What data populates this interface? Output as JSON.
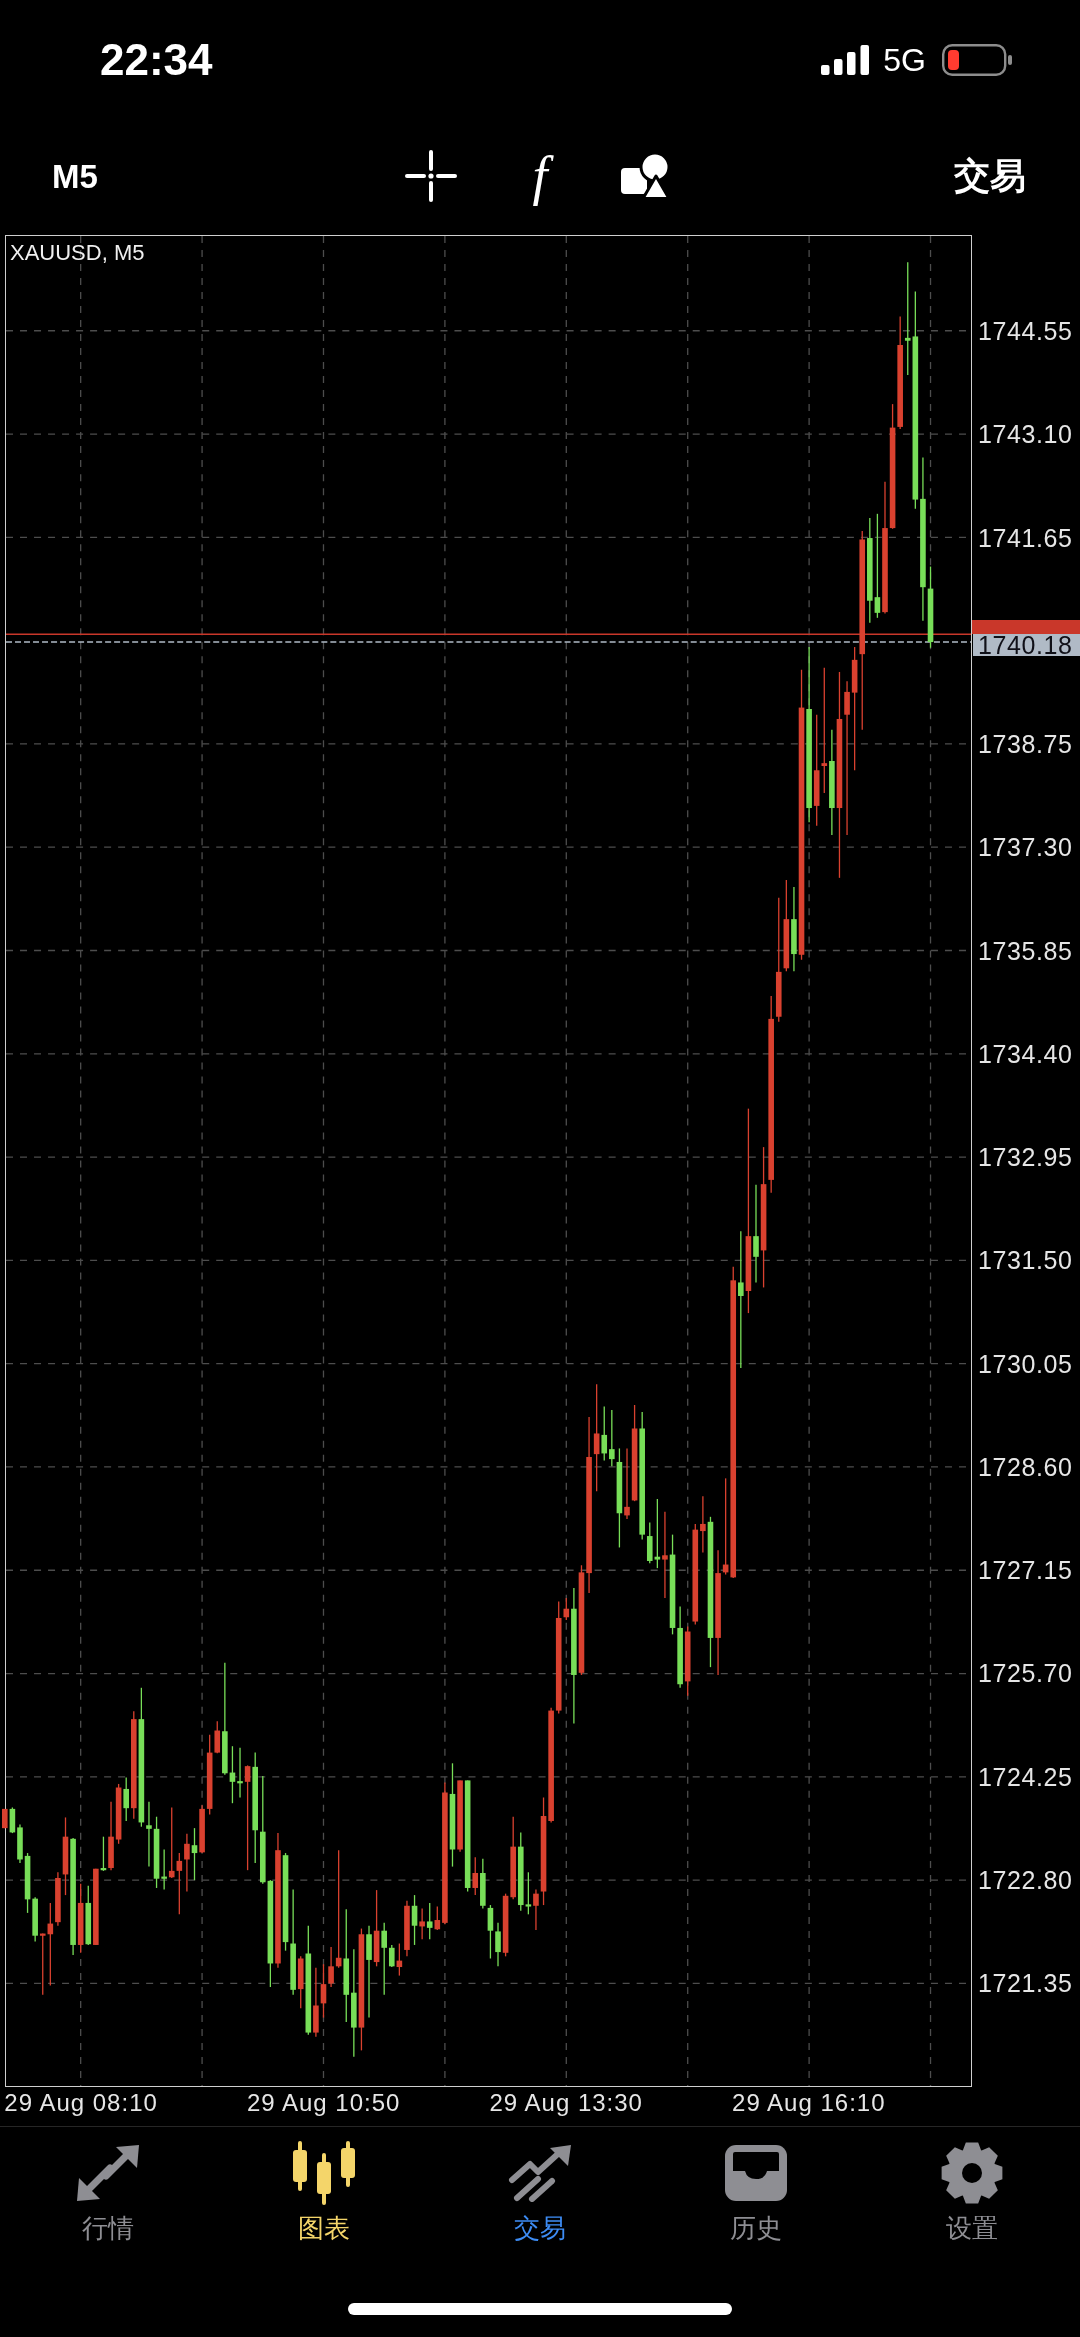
{
  "status_bar": {
    "time": "22:34",
    "network": "5G"
  },
  "toolbar": {
    "timeframe": "M5",
    "indicator_button": "f",
    "trade_button": "交易"
  },
  "chart": {
    "chart_data": {
      "type": "candlestick",
      "title": "XAUUSD, M5",
      "grid": true,
      "categories": [
        null,
        null,
        null,
        null,
        null,
        null,
        null,
        null,
        null,
        null,
        "29 Aug 08:10",
        null,
        null,
        null,
        null,
        null,
        null,
        null,
        null,
        null,
        null,
        null,
        null,
        null,
        null,
        null,
        null,
        null,
        null,
        null,
        null,
        null,
        null,
        null,
        null,
        null,
        null,
        null,
        null,
        null,
        null,
        null,
        "29 Aug 10:50",
        null,
        null,
        null,
        null,
        null,
        null,
        null,
        null,
        null,
        null,
        null,
        null,
        null,
        null,
        null,
        null,
        null,
        null,
        null,
        null,
        null,
        null,
        null,
        null,
        null,
        null,
        null,
        null,
        null,
        null,
        null,
        "29 Aug 13:30",
        null,
        null,
        null,
        null,
        null,
        null,
        null,
        null,
        null,
        null,
        null,
        null,
        null,
        null,
        null,
        null,
        null,
        null,
        null,
        null,
        null,
        null,
        null,
        null,
        null,
        null,
        null,
        null,
        null,
        null,
        null,
        "29 Aug 16:10",
        null,
        null,
        null,
        null,
        null,
        null,
        null,
        null,
        null,
        null,
        null,
        null,
        null,
        null,
        null,
        null
      ],
      "ohlc": [
        [
          1723.53,
          1723.8,
          1723.53,
          1723.8
        ],
        [
          1723.8,
          1723.82,
          1723.46,
          1723.47
        ],
        [
          1723.54,
          1723.58,
          1723.04,
          1723.09
        ],
        [
          1723.14,
          1723.18,
          1722.34,
          1722.53
        ],
        [
          1722.54,
          1722.56,
          1721.94,
          1722.02
        ],
        [
          1722.02,
          1722.05,
          1721.19,
          1722.05
        ],
        [
          1722.04,
          1722.48,
          1721.32,
          1722.19
        ],
        [
          1722.21,
          1722.91,
          1722.16,
          1722.83
        ],
        [
          1722.88,
          1723.68,
          1722.59,
          1723.41
        ],
        [
          1723.38,
          1723.39,
          1721.75,
          1721.89
        ],
        [
          1721.89,
          1722.75,
          1721.78,
          1722.48
        ],
        [
          1722.48,
          1722.72,
          1721.89,
          1721.9
        ],
        [
          1721.89,
          1722.96,
          1721.89,
          1722.96
        ],
        [
          1722.97,
          1723.41,
          1722.93,
          1722.94
        ],
        [
          1722.97,
          1723.9,
          1722.94,
          1723.41
        ],
        [
          1723.37,
          1724.15,
          1723.31,
          1724.1
        ],
        [
          1724.08,
          1724.24,
          1723.63,
          1723.81
        ],
        [
          1723.81,
          1725.17,
          1723.66,
          1725.06
        ],
        [
          1725.06,
          1725.5,
          1723.55,
          1723.61
        ],
        [
          1723.57,
          1723.9,
          1722.99,
          1723.52
        ],
        [
          1723.52,
          1723.69,
          1722.69,
          1722.82
        ],
        [
          1722.85,
          1723.23,
          1722.67,
          1722.82
        ],
        [
          1722.84,
          1723.82,
          1722.83,
          1722.93
        ],
        [
          1722.93,
          1723.18,
          1722.32,
          1723.07
        ],
        [
          1723.09,
          1723.45,
          1722.64,
          1723.31
        ],
        [
          1723.29,
          1723.53,
          1722.8,
          1723.18
        ],
        [
          1723.19,
          1723.85,
          1723.18,
          1723.8
        ],
        [
          1723.8,
          1724.84,
          1723.72,
          1724.59
        ],
        [
          1724.59,
          1725.03,
          1724.58,
          1724.9
        ],
        [
          1724.89,
          1725.85,
          1724.28,
          1724.3
        ],
        [
          1724.31,
          1724.68,
          1723.88,
          1724.18
        ],
        [
          1724.19,
          1724.66,
          1723.96,
          1724.17
        ],
        [
          1724.18,
          1724.41,
          1722.94,
          1724.4
        ],
        [
          1724.39,
          1724.59,
          1723.04,
          1723.5
        ],
        [
          1723.48,
          1724.26,
          1722.75,
          1722.77
        ],
        [
          1722.79,
          1722.8,
          1721.3,
          1721.63
        ],
        [
          1721.63,
          1723.46,
          1721.57,
          1723.22
        ],
        [
          1723.15,
          1723.18,
          1721.81,
          1721.93
        ],
        [
          1721.91,
          1722.67,
          1721.19,
          1721.26
        ],
        [
          1721.27,
          1721.73,
          1721.0,
          1721.7
        ],
        [
          1721.77,
          1722.16,
          1720.63,
          1720.66
        ],
        [
          1720.66,
          1721.57,
          1720.6,
          1721.04
        ],
        [
          1721.07,
          1721.62,
          1720.87,
          1721.34
        ],
        [
          1721.35,
          1721.86,
          1721.3,
          1721.59
        ],
        [
          1721.59,
          1723.22,
          1721.57,
          1721.71
        ],
        [
          1721.7,
          1722.39,
          1720.81,
          1721.19
        ],
        [
          1721.22,
          1721.83,
          1720.32,
          1720.73
        ],
        [
          1720.73,
          1722.12,
          1720.41,
          1722.04
        ],
        [
          1722.04,
          1722.16,
          1720.87,
          1721.68
        ],
        [
          1721.65,
          1722.66,
          1721.59,
          1722.09
        ],
        [
          1722.09,
          1722.2,
          1721.19,
          1721.85
        ],
        [
          1721.85,
          1721.89,
          1721.58,
          1721.59
        ],
        [
          1721.58,
          1721.91,
          1721.46,
          1721.67
        ],
        [
          1721.82,
          1722.51,
          1721.73,
          1722.44
        ],
        [
          1722.44,
          1722.59,
          1721.89,
          1722.16
        ],
        [
          1722.15,
          1722.4,
          1721.97,
          1722.22
        ],
        [
          1722.22,
          1722.48,
          1721.97,
          1722.13
        ],
        [
          1722.11,
          1722.43,
          1722.1,
          1722.24
        ],
        [
          1722.2,
          1724.17,
          1722.18,
          1724.03
        ],
        [
          1724.01,
          1724.44,
          1722.99,
          1723.23
        ],
        [
          1723.23,
          1724.2,
          1723.2,
          1724.2
        ],
        [
          1724.2,
          1724.2,
          1722.64,
          1722.69
        ],
        [
          1722.69,
          1723.12,
          1722.59,
          1722.9
        ],
        [
          1722.9,
          1723.1,
          1722.4,
          1722.44
        ],
        [
          1722.41,
          1722.45,
          1721.7,
          1722.09
        ],
        [
          1722.08,
          1722.2,
          1721.59,
          1721.79
        ],
        [
          1721.78,
          1722.61,
          1721.73,
          1722.58
        ],
        [
          1722.56,
          1723.69,
          1722.53,
          1723.27
        ],
        [
          1723.27,
          1723.47,
          1722.37,
          1722.45
        ],
        [
          1722.46,
          1722.91,
          1722.32,
          1722.44
        ],
        [
          1722.44,
          1722.67,
          1722.1,
          1722.61
        ],
        [
          1722.64,
          1723.96,
          1722.45,
          1723.7
        ],
        [
          1723.63,
          1725.22,
          1723.61,
          1725.18
        ],
        [
          1725.18,
          1726.71,
          1725.14,
          1726.48
        ],
        [
          1726.49,
          1726.76,
          1726.45,
          1726.61
        ],
        [
          1726.61,
          1726.9,
          1725.0,
          1725.68
        ],
        [
          1725.71,
          1727.22,
          1725.68,
          1727.12
        ],
        [
          1727.11,
          1729.3,
          1726.83,
          1728.74
        ],
        [
          1728.78,
          1729.76,
          1728.26,
          1729.07
        ],
        [
          1729.05,
          1729.45,
          1728.69,
          1728.79
        ],
        [
          1728.85,
          1729.4,
          1728.61,
          1728.71
        ],
        [
          1728.67,
          1728.86,
          1727.47,
          1727.95
        ],
        [
          1727.92,
          1728.86,
          1727.87,
          1728.04
        ],
        [
          1728.13,
          1729.47,
          1728.12,
          1729.14
        ],
        [
          1729.14,
          1729.37,
          1727.58,
          1727.65
        ],
        [
          1727.63,
          1727.82,
          1727.25,
          1727.28
        ],
        [
          1727.34,
          1728.15,
          1727.18,
          1727.3
        ],
        [
          1727.3,
          1727.97,
          1726.76,
          1727.36
        ],
        [
          1727.37,
          1727.65,
          1726.25,
          1726.34
        ],
        [
          1726.34,
          1726.64,
          1725.5,
          1725.55
        ],
        [
          1725.59,
          1726.36,
          1725.39,
          1726.29
        ],
        [
          1726.43,
          1727.8,
          1726.39,
          1727.72
        ],
        [
          1727.7,
          1728.19,
          1727.4,
          1727.8
        ],
        [
          1727.83,
          1727.9,
          1725.79,
          1726.2
        ],
        [
          1726.2,
          1727.43,
          1725.68,
          1727.11
        ],
        [
          1727.12,
          1728.44,
          1727.09,
          1727.23
        ],
        [
          1727.05,
          1731.41,
          1727.04,
          1731.22
        ],
        [
          1731.19,
          1731.91,
          1729.99,
          1731.0
        ],
        [
          1731.07,
          1733.63,
          1730.76,
          1731.84
        ],
        [
          1731.84,
          1732.56,
          1731.19,
          1731.55
        ],
        [
          1731.64,
          1733.09,
          1731.12,
          1732.57
        ],
        [
          1732.63,
          1735.21,
          1732.45,
          1734.89
        ],
        [
          1734.92,
          1736.59,
          1734.85,
          1735.55
        ],
        [
          1735.6,
          1736.84,
          1735.56,
          1736.29
        ],
        [
          1736.29,
          1736.74,
          1735.56,
          1735.8
        ],
        [
          1735.79,
          1739.79,
          1735.72,
          1739.26
        ],
        [
          1739.24,
          1740.11,
          1737.65,
          1737.85
        ],
        [
          1737.88,
          1739.16,
          1737.6,
          1738.38
        ],
        [
          1738.44,
          1739.82,
          1738.06,
          1738.48
        ],
        [
          1738.51,
          1738.95,
          1737.47,
          1737.85
        ],
        [
          1737.85,
          1739.76,
          1736.87,
          1739.1
        ],
        [
          1739.16,
          1739.63,
          1737.47,
          1739.48
        ],
        [
          1739.47,
          1740.11,
          1738.38,
          1739.93
        ],
        [
          1740.01,
          1741.74,
          1738.95,
          1741.62
        ],
        [
          1741.64,
          1741.92,
          1740.45,
          1740.76
        ],
        [
          1740.81,
          1741.98,
          1740.52,
          1740.59
        ],
        [
          1740.6,
          1742.43,
          1740.58,
          1741.78
        ],
        [
          1741.78,
          1743.52,
          1741.77,
          1743.19
        ],
        [
          1743.2,
          1744.75,
          1743.17,
          1744.35
        ],
        [
          1744.45,
          1745.51,
          1743.93,
          1744.41
        ],
        [
          1744.47,
          1745.1,
          1742.05,
          1742.18
        ],
        [
          1742.19,
          1742.77,
          1740.48,
          1740.95
        ],
        [
          1740.93,
          1741.24,
          1740.1,
          1740.18
        ]
      ],
      "ylim": [
        1719.91,
        1745.88
      ],
      "yticks": [
        {
          "value": 1744.55,
          "label": "1744.55"
        },
        {
          "value": 1743.1,
          "label": "1743.10"
        },
        {
          "value": 1741.65,
          "label": "1741.65"
        },
        {
          "value": 1738.75,
          "label": "1738.75"
        },
        {
          "value": 1737.3,
          "label": "1737.30"
        },
        {
          "value": 1735.85,
          "label": "1735.85"
        },
        {
          "value": 1734.4,
          "label": "1734.40"
        },
        {
          "value": 1732.95,
          "label": "1732.95"
        },
        {
          "value": 1731.5,
          "label": "1731.50"
        },
        {
          "value": 1730.05,
          "label": "1730.05"
        },
        {
          "value": 1728.6,
          "label": "1728.60"
        },
        {
          "value": 1727.15,
          "label": "1727.15"
        },
        {
          "value": 1725.7,
          "label": "1725.70"
        },
        {
          "value": 1724.25,
          "label": "1724.25"
        },
        {
          "value": 1722.8,
          "label": "1722.80"
        },
        {
          "value": 1721.35,
          "label": "1721.35"
        }
      ],
      "ref_lines": [
        {
          "axis": "y",
          "value": 1740.29,
          "color": "#c9372a"
        },
        {
          "axis": "y",
          "value": 1740.18,
          "color": "#b0bac6",
          "label": "1740.18"
        }
      ]
    }
  },
  "tab_bar": {
    "tabs": [
      {
        "label": "行情",
        "selected": false,
        "kind": "tab"
      },
      {
        "label": "图表",
        "selected": true,
        "kind": "tab"
      },
      {
        "label": "交易",
        "selected": false,
        "kind": "action"
      },
      {
        "label": "历史",
        "selected": false,
        "kind": "tab"
      },
      {
        "label": "设置",
        "selected": false,
        "kind": "tab"
      }
    ]
  }
}
